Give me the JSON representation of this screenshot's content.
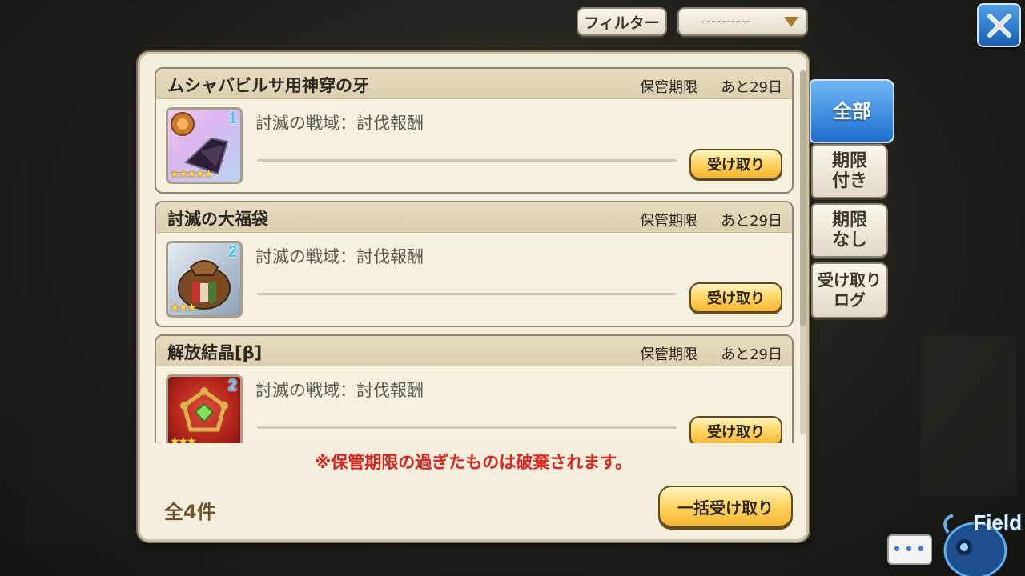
{
  "filter": {
    "button_label": "フィルター",
    "select_value": "----------"
  },
  "items": [
    {
      "name": "ムシャバビルサ用神穿の牙",
      "expiry_label": "保管期限",
      "expiry_value": "あと29日",
      "source": "討滅の戦域：討伐報酬",
      "count": "1",
      "rarity_stars": 5,
      "icon": "fang-icon",
      "receive_label": "受け取り"
    },
    {
      "name": "討滅の大福袋",
      "expiry_label": "保管期限",
      "expiry_value": "あと29日",
      "source": "討滅の戦域：討伐報酬",
      "count": "2",
      "rarity_stars": 3,
      "icon": "lucky-bag-icon",
      "receive_label": "受け取り"
    },
    {
      "name": "解放結晶[β]",
      "expiry_label": "保管期限",
      "expiry_value": "あと29日",
      "source": "討滅の戦域：討伐報酬",
      "count": "2",
      "rarity_stars": 3,
      "icon": "release-crystal-icon",
      "receive_label": "受け取り"
    }
  ],
  "warning": "※保管期限の過ぎたものは破棄されます。",
  "total": "全4件",
  "bulk_receive_label": "一括受け取り",
  "tabs": [
    {
      "label": "全部",
      "active": true
    },
    {
      "label": "期限\n付き",
      "active": false
    },
    {
      "label": "期限\nなし",
      "active": false
    },
    {
      "label": "受け取り\nログ",
      "active": false
    }
  ],
  "field_label": "Field",
  "chat_label": "•••",
  "colors": {
    "panel_bg": "#f4eedd",
    "warning": "#e0231c",
    "active_tab": "#1d6ed0",
    "button_gold": "#ffd868"
  }
}
